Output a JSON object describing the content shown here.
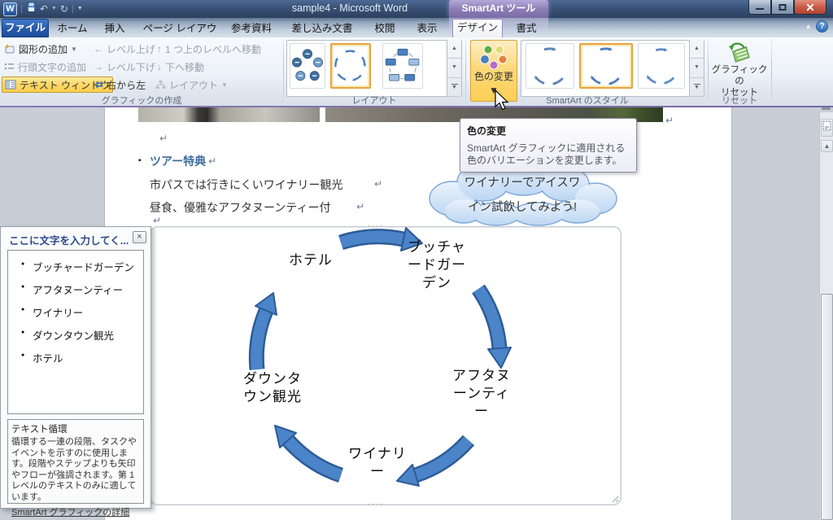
{
  "window": {
    "title": "sample4  -  Microsoft Word",
    "contextual_group": "SmartArt ツール"
  },
  "tabs": {
    "file": "ファイル",
    "main": [
      "ホーム",
      "挿入",
      "ページ レイアウト",
      "参考資料",
      "差し込み文書",
      "校閲",
      "表示"
    ],
    "contextual": [
      "デザイン",
      "書式"
    ]
  },
  "ribbon": {
    "create_graphic": {
      "add_shape": "図形の追加",
      "add_bullet": "行頭文字の追加",
      "text_pane": "テキスト ウィンドウ",
      "promote": "レベル上げ",
      "demote": "レベル下げ",
      "right_to_left": "右から左",
      "move_up": "1 つ上のレベルへ移動",
      "move_down": "下へ移動",
      "layout": "レイアウト",
      "group_label": "グラフィックの作成"
    },
    "layout_gallery": {
      "group_label": "レイアウト"
    },
    "styles": {
      "change_colors_label": "色の変更",
      "group_label": "SmartArt のスタイル"
    },
    "reset": {
      "button_label": "グラフィックの\nリセット",
      "group_label": "リセット"
    }
  },
  "icons": {
    "caret_down": "▼",
    "scroll_up": "▲",
    "scroll_down": "▼",
    "arrow_left": "←",
    "arrow_right": "→",
    "arrow_up": "↑",
    "arrow_down": "↓",
    "swap": "⇄",
    "help": "?",
    "bullet_dot": "●",
    "undo": "↶",
    "redo": "↻"
  },
  "tooltip": {
    "title": "色の変更",
    "body": "SmartArt グラフィックに適用される\n色のバリエーションを変更します。"
  },
  "document": {
    "pilcrow": "↵",
    "heading_bullet": "▪",
    "heading": "ツアー特典",
    "body_lines": [
      "市パスでは行きにくいワイナリー観光",
      "昼食、優雅なアフタヌーンティー付"
    ],
    "callout": "ワイナリーでアイスワ\nイン試飲してみよう!"
  },
  "text_pane": {
    "title": "ここに文字を入力してく...",
    "items": [
      "ブッチャードガーデン",
      "アフタヌーンティー",
      "ワイナリー",
      "ダウンタウン観光",
      "ホテル"
    ],
    "info_title": "テキスト循環",
    "info_body": "循環する一連の段階、タスクやイベントを示すのに使用します。段階やステップよりも矢印やフローが強調されます。第 1 レベルのテキストのみに適しています。",
    "info_link": "SmartArt グラフィックの詳細"
  },
  "diagram": {
    "nodes": [
      "ホテル",
      "ブッチャ\nードガー\nデン",
      "アフタヌ\nーンティ\nー",
      "ワイナリ\nー",
      "ダウンタ\nウン観光"
    ]
  }
}
